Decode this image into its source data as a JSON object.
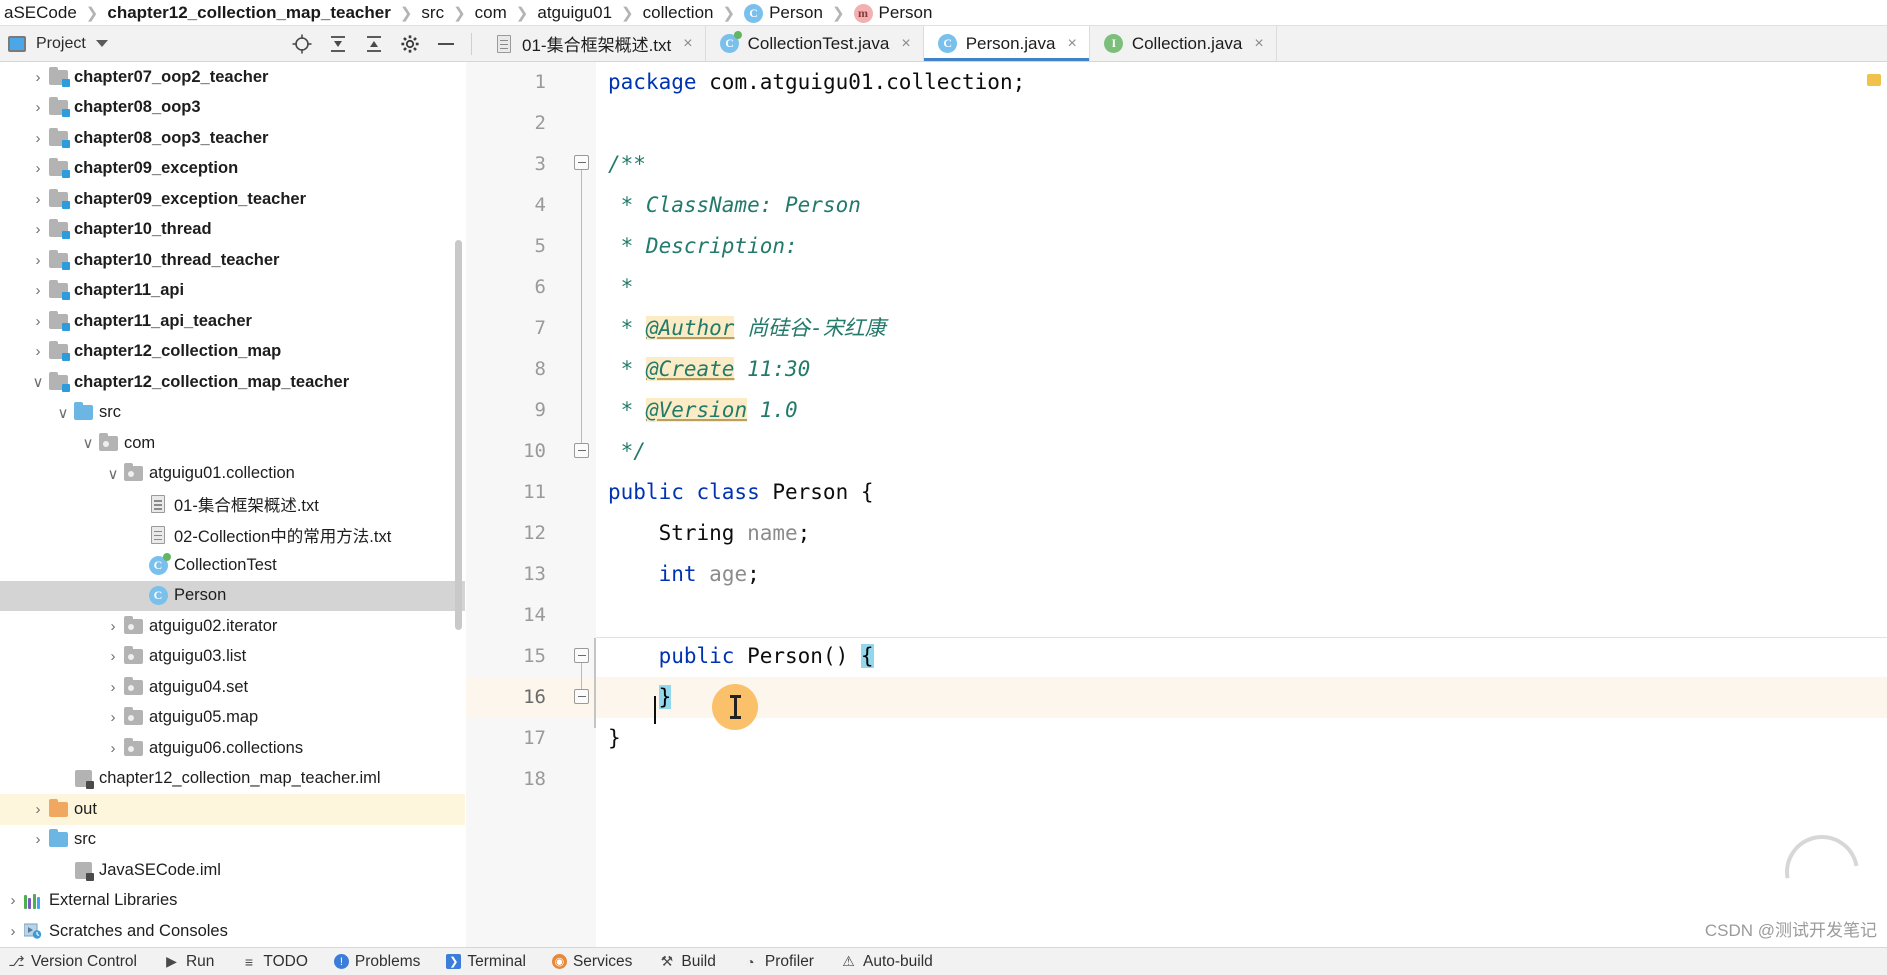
{
  "breadcrumb": {
    "items": [
      {
        "label": "aSECode",
        "icon": "",
        "bold": false,
        "clipped": true
      },
      {
        "label": "chapter12_collection_map_teacher",
        "icon": "",
        "bold": true
      },
      {
        "label": "src",
        "icon": "",
        "bold": false
      },
      {
        "label": "com",
        "icon": "",
        "bold": false
      },
      {
        "label": "atguigu01",
        "icon": "",
        "bold": false
      },
      {
        "label": "collection",
        "icon": "",
        "bold": false
      },
      {
        "label": "Person",
        "icon": "class-icon",
        "bold": false
      },
      {
        "label": "Person",
        "icon": "method-icon",
        "bold": false
      }
    ],
    "separator": "❯"
  },
  "toolwindow": {
    "title": "Project",
    "dropdown_caret": "caret-down-icon",
    "actions": [
      {
        "name": "locate-in-tree-icon",
        "tooltip": "Select Opened File"
      },
      {
        "name": "expand-all-icon",
        "tooltip": "Expand All"
      },
      {
        "name": "collapse-all-icon",
        "tooltip": "Collapse All"
      },
      {
        "name": "settings-gear-icon",
        "tooltip": "Options"
      },
      {
        "name": "hide-icon",
        "tooltip": "Hide"
      }
    ]
  },
  "tabs": [
    {
      "label": "01-集合框架概述.txt",
      "icon": "text-file-icon",
      "active": false,
      "close": "×"
    },
    {
      "label": "CollectionTest.java",
      "icon": "java-test-class-icon",
      "active": false,
      "close": "×"
    },
    {
      "label": "Person.java",
      "icon": "java-class-icon",
      "active": true,
      "close": "×"
    },
    {
      "label": "Collection.java",
      "icon": "java-interface-icon",
      "active": false,
      "close": "×"
    }
  ],
  "tree": [
    {
      "label": "chapter07_oop2_teacher",
      "indent": 1,
      "chevron": "›",
      "icon": "module-folder-icon",
      "bold": true
    },
    {
      "label": "chapter08_oop3",
      "indent": 1,
      "chevron": "›",
      "icon": "module-folder-icon",
      "bold": true
    },
    {
      "label": "chapter08_oop3_teacher",
      "indent": 1,
      "chevron": "›",
      "icon": "module-folder-icon",
      "bold": true
    },
    {
      "label": "chapter09_exception",
      "indent": 1,
      "chevron": "›",
      "icon": "module-folder-icon",
      "bold": true
    },
    {
      "label": "chapter09_exception_teacher",
      "indent": 1,
      "chevron": "›",
      "icon": "module-folder-icon",
      "bold": true
    },
    {
      "label": "chapter10_thread",
      "indent": 1,
      "chevron": "›",
      "icon": "module-folder-icon",
      "bold": true
    },
    {
      "label": "chapter10_thread_teacher",
      "indent": 1,
      "chevron": "›",
      "icon": "module-folder-icon",
      "bold": true
    },
    {
      "label": "chapter11_api",
      "indent": 1,
      "chevron": "›",
      "icon": "module-folder-icon",
      "bold": true
    },
    {
      "label": "chapter11_api_teacher",
      "indent": 1,
      "chevron": "›",
      "icon": "module-folder-icon",
      "bold": true
    },
    {
      "label": "chapter12_collection_map",
      "indent": 1,
      "chevron": "›",
      "icon": "module-folder-icon",
      "bold": true
    },
    {
      "label": "chapter12_collection_map_teacher",
      "indent": 1,
      "chevron": "∨",
      "icon": "module-folder-icon",
      "bold": true
    },
    {
      "label": "src",
      "indent": 2,
      "chevron": "∨",
      "icon": "source-folder-icon",
      "bold": false
    },
    {
      "label": "com",
      "indent": 3,
      "chevron": "∨",
      "icon": "package-folder-icon",
      "bold": false
    },
    {
      "label": "atguigu01.collection",
      "indent": 4,
      "chevron": "∨",
      "icon": "package-folder-icon",
      "bold": false
    },
    {
      "label": "01-集合框架概述.txt",
      "indent": 5,
      "chevron": "",
      "icon": "text-file-icon",
      "bold": false
    },
    {
      "label": "02-Collection中的常用方法.txt",
      "indent": 5,
      "chevron": "",
      "icon": "text-file-icon",
      "bold": false
    },
    {
      "label": "CollectionTest",
      "indent": 5,
      "chevron": "",
      "icon": "java-test-class-icon",
      "bold": false
    },
    {
      "label": "Person",
      "indent": 5,
      "chevron": "",
      "icon": "java-class-icon",
      "bold": false,
      "selected": true
    },
    {
      "label": "atguigu02.iterator",
      "indent": 4,
      "chevron": "›",
      "icon": "package-folder-icon",
      "bold": false
    },
    {
      "label": "atguigu03.list",
      "indent": 4,
      "chevron": "›",
      "icon": "package-folder-icon",
      "bold": false
    },
    {
      "label": "atguigu04.set",
      "indent": 4,
      "chevron": "›",
      "icon": "package-folder-icon",
      "bold": false
    },
    {
      "label": "atguigu05.map",
      "indent": 4,
      "chevron": "›",
      "icon": "package-folder-icon",
      "bold": false
    },
    {
      "label": "atguigu06.collections",
      "indent": 4,
      "chevron": "›",
      "icon": "package-folder-icon",
      "bold": false
    },
    {
      "label": "chapter12_collection_map_teacher.iml",
      "indent": 2,
      "chevron": "",
      "icon": "iml-file-icon",
      "bold": false
    },
    {
      "label": "out",
      "indent": 1,
      "chevron": "›",
      "icon": "excluded-folder-icon",
      "bold": false,
      "highlight": "out"
    },
    {
      "label": "src",
      "indent": 1,
      "chevron": "›",
      "icon": "source-folder-icon",
      "bold": false
    },
    {
      "label": "JavaSECode.iml",
      "indent": 2,
      "chevron": "",
      "icon": "iml-file-icon",
      "bold": false
    },
    {
      "label": "External Libraries",
      "indent": 0,
      "chevron": "›",
      "icon": "libraries-icon",
      "bold": false
    },
    {
      "label": "Scratches and Consoles",
      "indent": 0,
      "chevron": "›",
      "icon": "scratches-icon",
      "bold": false
    }
  ],
  "editor": {
    "filename": "Person.java",
    "lines": [
      {
        "n": "1",
        "tokens": [
          {
            "t": "package",
            "c": "kw"
          },
          {
            "t": " com.atguigu01.collection;",
            "c": "plain"
          }
        ]
      },
      {
        "n": "2",
        "tokens": []
      },
      {
        "n": "3",
        "tokens": [
          {
            "t": "/**",
            "c": "cmt"
          }
        ],
        "fold": "start"
      },
      {
        "n": "4",
        "tokens": [
          {
            "t": " * ClassName: Person",
            "c": "cmt"
          }
        ]
      },
      {
        "n": "5",
        "tokens": [
          {
            "t": " * Description:",
            "c": "cmt"
          }
        ]
      },
      {
        "n": "6",
        "tokens": [
          {
            "t": " *",
            "c": "cmt"
          }
        ]
      },
      {
        "n": "7",
        "tokens": [
          {
            "t": " * ",
            "c": "cmt"
          },
          {
            "t": "@Author",
            "c": "tagmark"
          },
          {
            "t": " 尚硅谷-宋红康",
            "c": "cmt"
          }
        ]
      },
      {
        "n": "8",
        "tokens": [
          {
            "t": " * ",
            "c": "cmt"
          },
          {
            "t": "@Create",
            "c": "tagmark"
          },
          {
            "t": " 11:30",
            "c": "cmt"
          }
        ]
      },
      {
        "n": "9",
        "tokens": [
          {
            "t": " * ",
            "c": "cmt"
          },
          {
            "t": "@Version",
            "c": "tagmark"
          },
          {
            "t": " 1.0",
            "c": "cmt"
          }
        ]
      },
      {
        "n": "10",
        "tokens": [
          {
            "t": " */",
            "c": "cmt"
          }
        ],
        "fold": "end"
      },
      {
        "n": "11",
        "tokens": [
          {
            "t": "public class",
            "c": "kw"
          },
          {
            "t": " Person {",
            "c": "plain"
          }
        ]
      },
      {
        "n": "12",
        "tokens": [
          {
            "t": "    String ",
            "c": "plain"
          },
          {
            "t": "name",
            "c": "field"
          },
          {
            "t": ";",
            "c": "plain"
          }
        ]
      },
      {
        "n": "13",
        "tokens": [
          {
            "t": "    ",
            "c": "plain"
          },
          {
            "t": "int",
            "c": "kw"
          },
          {
            "t": " ",
            "c": "plain"
          },
          {
            "t": "age",
            "c": "field"
          },
          {
            "t": ";",
            "c": "plain"
          }
        ]
      },
      {
        "n": "14",
        "tokens": []
      },
      {
        "n": "15",
        "tokens": [
          {
            "t": "    ",
            "c": "plain"
          },
          {
            "t": "public",
            "c": "kw"
          },
          {
            "t": " Person() ",
            "c": "plain"
          },
          {
            "t": "{",
            "c": "brace-hl"
          }
        ],
        "fold": "start"
      },
      {
        "n": "16",
        "tokens": [
          {
            "t": "    ",
            "c": "plain"
          },
          {
            "t": "}",
            "c": "brace-hl"
          }
        ],
        "current": true,
        "fold": "end"
      },
      {
        "n": "17",
        "tokens": [
          {
            "t": "}",
            "c": "plain"
          }
        ]
      },
      {
        "n": "18",
        "tokens": []
      }
    ],
    "caret": {
      "line": 16,
      "column": 6
    }
  },
  "statusbar": {
    "items": [
      {
        "label": "Version Control",
        "icon": "branch-icon"
      },
      {
        "label": "Run",
        "icon": "play-icon"
      },
      {
        "label": "TODO",
        "icon": "todo-list-icon"
      },
      {
        "label": "Problems",
        "icon": "problems-icon"
      },
      {
        "label": "Terminal",
        "icon": "terminal-icon"
      },
      {
        "label": "Services",
        "icon": "services-icon"
      },
      {
        "label": "Build",
        "icon": "build-hammer-icon"
      },
      {
        "label": "Profiler",
        "icon": "profiler-icon"
      },
      {
        "label": "Auto-build",
        "icon": "auto-build-icon"
      }
    ]
  },
  "watermark": "CSDN @测试开发笔记"
}
